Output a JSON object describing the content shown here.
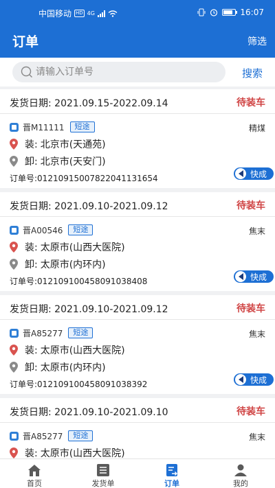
{
  "status_bar": {
    "carrier": "中国移动",
    "hd": "HD",
    "network": "4G",
    "time": "16:07"
  },
  "header": {
    "title": "订单",
    "filter_label": "筛选"
  },
  "search": {
    "placeholder": "请输入订单号",
    "value": "",
    "button_label": "搜索"
  },
  "labels": {
    "load": "装:",
    "unload": "卸:",
    "order_no": "订单号:",
    "badge": "快成"
  },
  "orders": [
    {
      "date": "发货日期:  2021.09.15-2022.09.14",
      "status": "待装车",
      "plate": "晋M11111",
      "tag": "短途",
      "goods": "精煤",
      "load_addr": "北京市(天通苑)",
      "unload_addr": "北京市(天安门)",
      "order_no": "012109150078220411316​54"
    },
    {
      "date": "发货日期:  2021.09.10-2021.09.12",
      "status": "待装车",
      "plate": "晋A00546",
      "tag": "短途",
      "goods": "焦末",
      "load_addr": "太原市(山西大医院)",
      "unload_addr": "太原市(内环内)",
      "order_no": "012109100458091038408"
    },
    {
      "date": "发货日期:  2021.09.10-2021.09.12",
      "status": "待装车",
      "plate": "晋A85277",
      "tag": "短途",
      "goods": "焦末",
      "load_addr": "太原市(山西大医院)",
      "unload_addr": "太原市(内环内)",
      "order_no": "012109100458091038392"
    },
    {
      "date": "发货日期:  2021.09.10-2021.09.10",
      "status": "待装车",
      "plate": "晋A85277",
      "tag": "短途",
      "goods": "焦末",
      "load_addr": "太原市(山西大医院)",
      "unload_addr": "",
      "order_no": ""
    }
  ],
  "tabs": [
    {
      "label": "首页",
      "icon": "home-icon",
      "active": false
    },
    {
      "label": "发货单",
      "icon": "list-icon",
      "active": false
    },
    {
      "label": "订单",
      "icon": "order-icon",
      "active": true
    },
    {
      "label": "我的",
      "icon": "user-icon",
      "active": false
    }
  ],
  "colors": {
    "primary": "#1d6fd4",
    "status": "#d04545",
    "load_pin": "#d9534f",
    "unload_pin": "#8a8a8a"
  }
}
